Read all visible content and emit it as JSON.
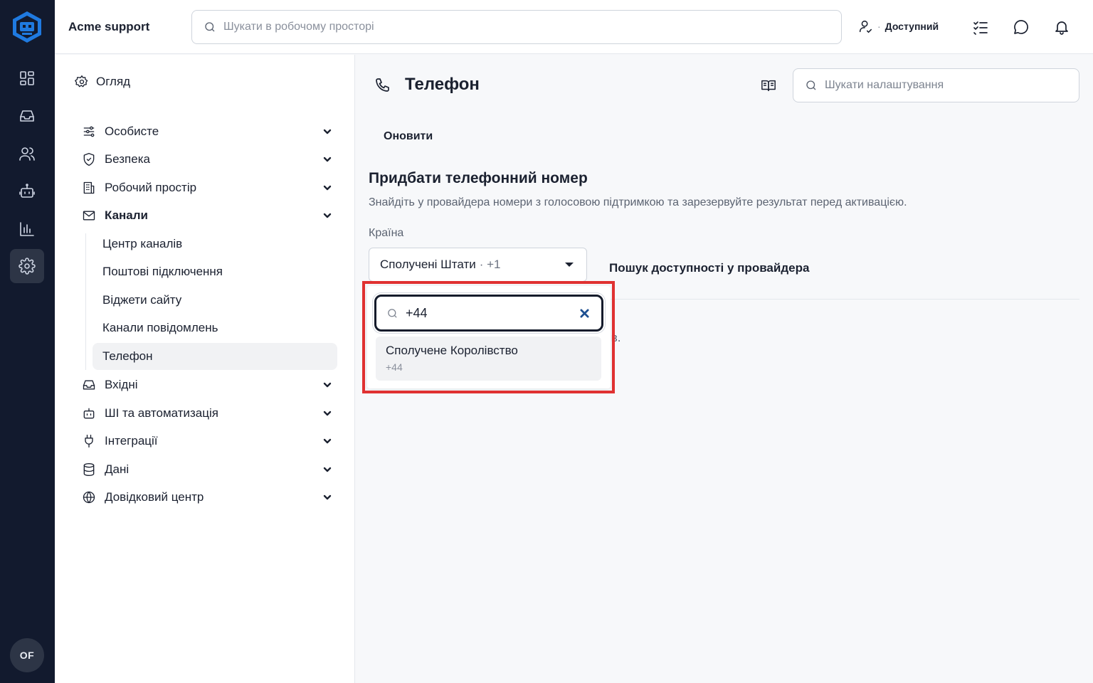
{
  "workspace": {
    "name": "Acme support"
  },
  "topbar": {
    "search_placeholder": "Шукати в робочому просторі",
    "status_label": "Доступний",
    "status_separator": "·"
  },
  "rail": {
    "items": [
      "dashboard-icon",
      "inbox-icon",
      "users-icon",
      "bot-icon",
      "analytics-icon",
      "settings-icon"
    ],
    "active": "settings-icon",
    "avatar_initials": "OF"
  },
  "sidebar": {
    "overview": "Огляд",
    "groups": [
      {
        "label": "Особисте",
        "icon": "sliders-icon"
      },
      {
        "label": "Безпека",
        "icon": "shield-icon"
      },
      {
        "label": "Робочий простір",
        "icon": "building-icon"
      },
      {
        "label": "Канали",
        "icon": "mail-icon",
        "open": true
      },
      {
        "label": "Вхідні",
        "icon": "inbox-icon"
      },
      {
        "label": "ШІ та автоматизація",
        "icon": "bot-icon"
      },
      {
        "label": "Інтеграції",
        "icon": "plug-icon"
      },
      {
        "label": "Дані",
        "icon": "database-icon"
      },
      {
        "label": "Довідковий центр",
        "icon": "globe-icon"
      }
    ],
    "channel_items": [
      "Центр каналів",
      "Поштові підключення",
      "Віджети сайту",
      "Канали повідомлень",
      "Телефон"
    ],
    "active_item": "Телефон"
  },
  "main": {
    "title": "Телефон",
    "settings_search_placeholder": "Шукати налаштування",
    "refresh_label": "Оновити",
    "section_title": "Придбати телефонний номер",
    "section_desc": "Знайдіть у провайдера номери з голосовою підтримкою та зарезервуйте результат перед активацією.",
    "country_label": "Країна",
    "country_selected": "Сполучені Штати",
    "country_selected_code": "· +1",
    "provider_search_label": "Пошук доступності у провайдера",
    "partial_text": "ів."
  },
  "dropdown": {
    "search_value": "+44",
    "options": [
      {
        "name": "Сполучене Королівство",
        "dial": "+44"
      }
    ]
  },
  "colors": {
    "rail_bg": "#121a2e",
    "highlight": "#e03131",
    "clear_icon": "#1d4f91"
  }
}
